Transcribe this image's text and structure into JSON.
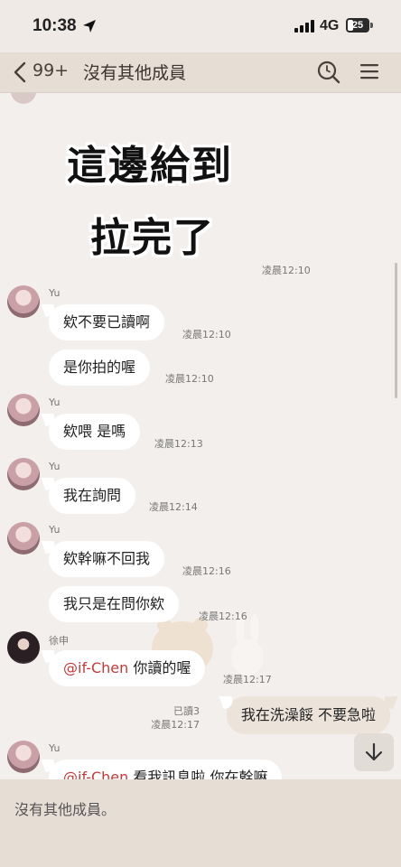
{
  "status_bar": {
    "time": "10:38",
    "network": "4G",
    "battery": "25",
    "battery_level": 0.25
  },
  "nav": {
    "back_count": "99+",
    "title": "沒有其他成員"
  },
  "chat": {
    "sticker_lines": [
      "這邊給到",
      "拉完了"
    ],
    "sticker_time": "凌晨12:10",
    "messages": [
      {
        "sender": "Yu",
        "text": "欸不要已讀啊",
        "time": "凌晨12:10"
      },
      {
        "text": "是你拍的喔",
        "time": "凌晨12:10"
      },
      {
        "sender": "Yu",
        "text": "欸喂 是嗎",
        "time": "凌晨12:13"
      },
      {
        "sender": "Yu",
        "text": "我在詢問",
        "time": "凌晨12:14"
      },
      {
        "sender": "Yu",
        "text": "欸幹嘛不回我",
        "time": "凌晨12:16"
      },
      {
        "text": "我只是在問你欸",
        "time": "凌晨12:16"
      },
      {
        "sender": "徐申",
        "mention": "@if-Chen",
        "text": " 你讀的喔",
        "time": "凌晨12:17"
      },
      {
        "outgoing": true,
        "read": "已讀3",
        "text": "我在洗澡餒 不要急啦",
        "time": "凌晨12:17"
      },
      {
        "sender": "Yu",
        "mention": "@if-Chen",
        "text": " 看我訊息啦 你在幹嘛"
      }
    ]
  },
  "input": {
    "placeholder": "沒有其他成員。"
  },
  "icons": {
    "back": "chevron-left-icon",
    "search": "search-icon",
    "menu": "menu-icon",
    "scroll_down": "arrow-down-icon",
    "location": "location-arrow-icon"
  }
}
